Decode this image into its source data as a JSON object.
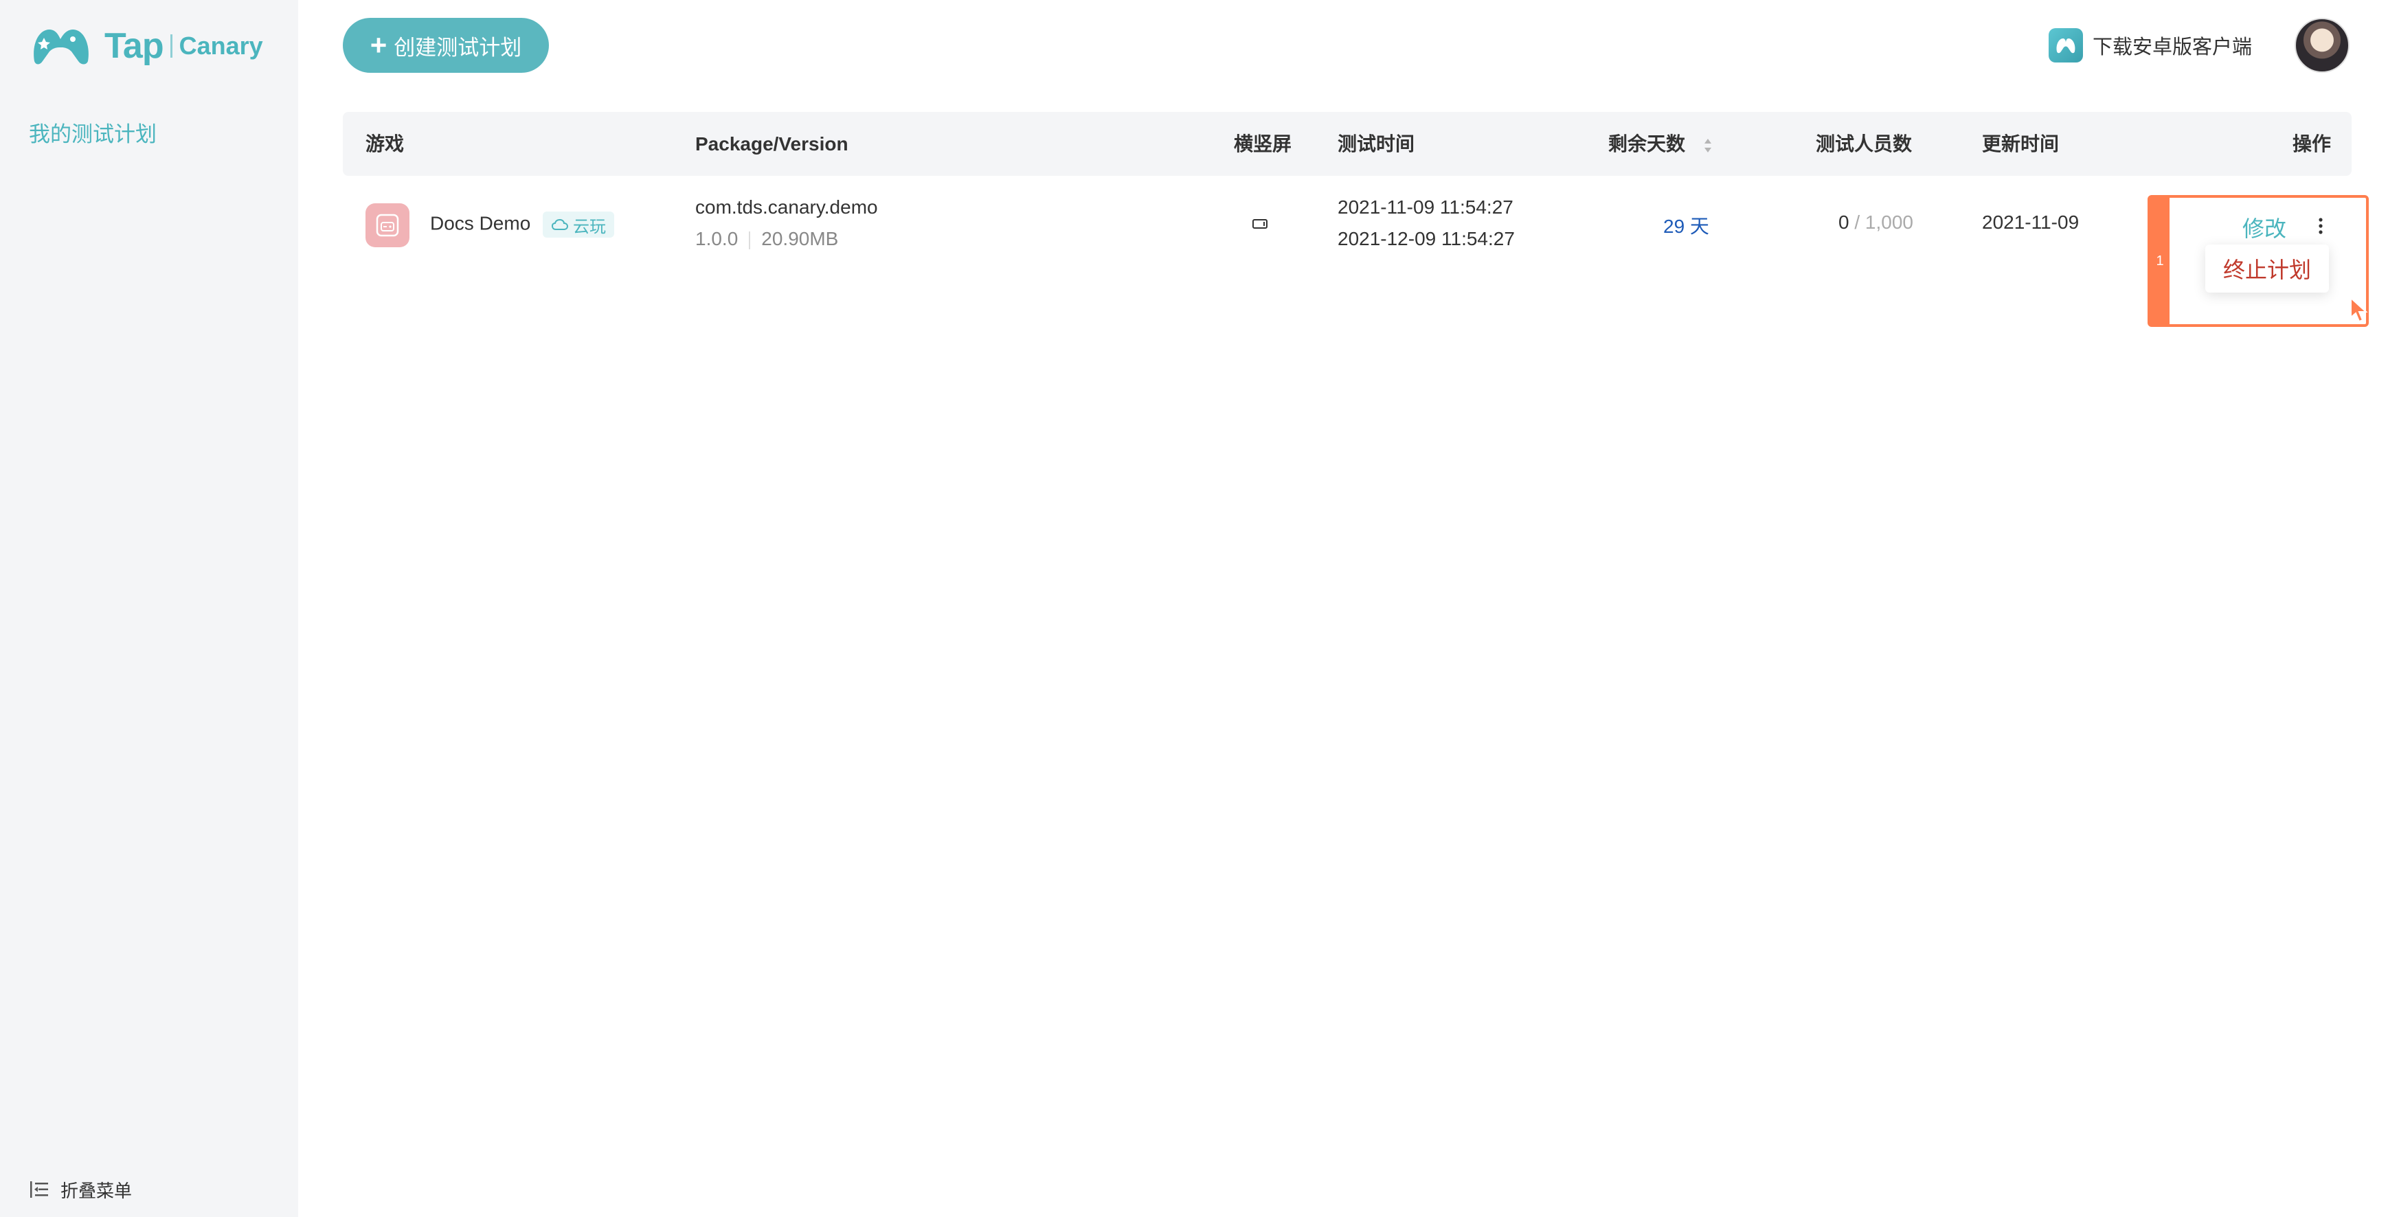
{
  "brand": {
    "name": "Tap",
    "product": "Canary",
    "color": "#4bb5be"
  },
  "sidebar": {
    "nav": [
      {
        "label": "我的测试计划",
        "active": true
      }
    ],
    "collapse_label": "折叠菜单"
  },
  "header": {
    "create_plan_label": "创建测试计划",
    "download_label": "下载安卓版客户端"
  },
  "table": {
    "columns": [
      "游戏",
      "Package/Version",
      "横竖屏",
      "测试时间",
      "剩余天数",
      "测试人员数",
      "更新时间",
      "操作"
    ],
    "rows": [
      {
        "game_name": "Docs Demo",
        "tag": "云玩",
        "package": "com.tds.canary.demo",
        "version": "1.0.0",
        "size": "20.90MB",
        "orientation_icon": "landscape-icon",
        "start_time": "2021-11-09 11:54:27",
        "end_time": "2021-12-09 11:54:27",
        "remaining_days": "29 天",
        "testers_current": "0",
        "testers_max": "/ 1,000",
        "updated": "2021-11-09",
        "edit_label": "修改",
        "menu_item": "终止计划"
      }
    ]
  },
  "annotation": {
    "step": "1",
    "color": "#ff7e4e"
  }
}
